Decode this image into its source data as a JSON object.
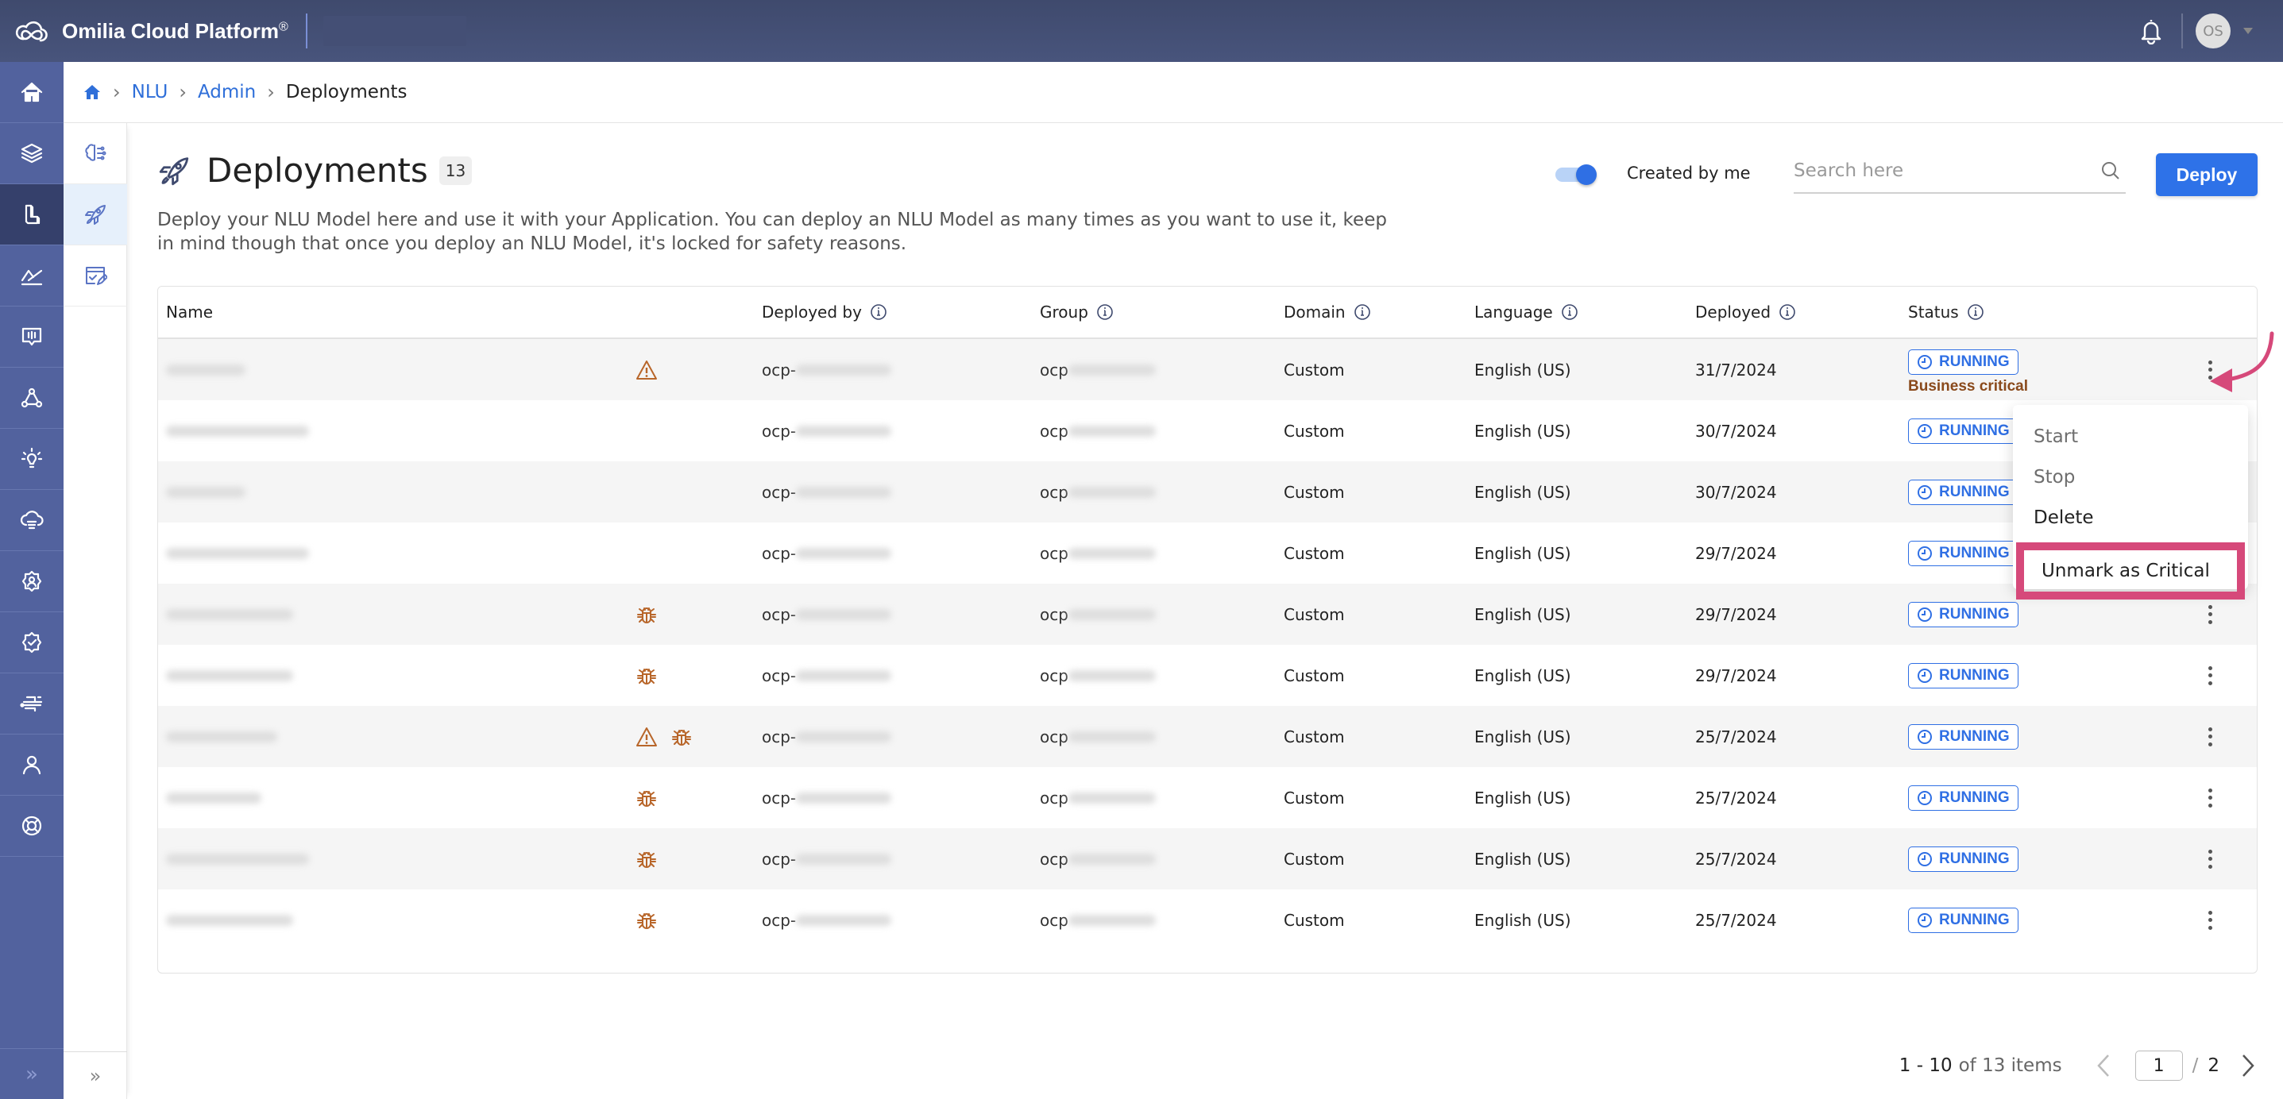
{
  "topbar": {
    "brand_name": "Omilia Cloud Platform",
    "brand_mark": "®",
    "avatar_initials": "OS"
  },
  "rail": {
    "items": [
      {
        "icon": "home-icon",
        "active": false
      },
      {
        "icon": "layers-icon",
        "active": false
      },
      {
        "icon": "nlu-blocks-icon",
        "active": true
      },
      {
        "icon": "analytics-icon",
        "active": false
      },
      {
        "icon": "reports-icon",
        "active": false
      },
      {
        "icon": "network-icon",
        "active": false
      },
      {
        "icon": "lightbulb-icon",
        "active": false
      },
      {
        "icon": "cloud-data-icon",
        "active": false
      },
      {
        "icon": "user-settings-icon",
        "active": false
      },
      {
        "icon": "badge-check-icon",
        "active": false
      },
      {
        "icon": "circuit-icon",
        "active": false
      },
      {
        "icon": "user-icon",
        "active": false
      },
      {
        "icon": "support-icon",
        "active": false
      }
    ],
    "expand_glyph": "»"
  },
  "subbar": {
    "items": [
      {
        "icon": "brain-icon",
        "active": false
      },
      {
        "icon": "rocket-icon",
        "active": true
      },
      {
        "icon": "form-edit-icon",
        "active": false
      }
    ],
    "expand_glyph": "»"
  },
  "breadcrumb": {
    "items": [
      "NLU",
      "Admin"
    ],
    "current": "Deployments",
    "separator": "›"
  },
  "page": {
    "title": "Deployments",
    "count": "13",
    "description": "Deploy your NLU Model here and use it with your Application. You can deploy an NLU Model as many times as you want to use it, keep in mind though that once you deploy an NLU Model, it's locked for safety reasons.",
    "toggle_label": "Created by me",
    "toggle_on": true,
    "search_placeholder": "Search here",
    "search_value": "",
    "deploy_label": "Deploy"
  },
  "table": {
    "columns": [
      "Name",
      "Deployed by",
      "Group",
      "Domain",
      "Language",
      "Deployed",
      "Status"
    ],
    "rows": [
      {
        "name_redacted": true,
        "name_len": 5,
        "flags": [
          "warning"
        ],
        "deployed_by": "ocp-",
        "group": "ocp",
        "domain": "Custom",
        "language": "English (US)",
        "deployed": "31/7/2024",
        "status": "RUNNING",
        "critical": "Business critical"
      },
      {
        "name_redacted": true,
        "name_len": 9,
        "flags": [],
        "deployed_by": "ocp-",
        "group": "ocp",
        "domain": "Custom",
        "language": "English (US)",
        "deployed": "30/7/2024",
        "status": "RUNNING",
        "critical": ""
      },
      {
        "name_redacted": true,
        "name_len": 5,
        "flags": [],
        "deployed_by": "ocp-",
        "group": "ocp",
        "domain": "Custom",
        "language": "English (US)",
        "deployed": "30/7/2024",
        "status": "RUNNING",
        "critical": ""
      },
      {
        "name_redacted": true,
        "name_len": 9,
        "flags": [],
        "deployed_by": "ocp-",
        "group": "ocp",
        "domain": "Custom",
        "language": "English (US)",
        "deployed": "29/7/2024",
        "status": "RUNNING",
        "critical": ""
      },
      {
        "name_redacted": true,
        "name_len": 8,
        "flags": [
          "bug"
        ],
        "deployed_by": "ocp-",
        "group": "ocp",
        "domain": "Custom",
        "language": "English (US)",
        "deployed": "29/7/2024",
        "status": "RUNNING",
        "critical": ""
      },
      {
        "name_redacted": true,
        "name_len": 8,
        "flags": [
          "bug"
        ],
        "deployed_by": "ocp-",
        "group": "ocp",
        "domain": "Custom",
        "language": "English (US)",
        "deployed": "29/7/2024",
        "status": "RUNNING",
        "critical": ""
      },
      {
        "name_redacted": true,
        "name_len": 7,
        "flags": [
          "warning",
          "bug"
        ],
        "deployed_by": "ocp-",
        "group": "ocp",
        "domain": "Custom",
        "language": "English (US)",
        "deployed": "25/7/2024",
        "status": "RUNNING",
        "critical": ""
      },
      {
        "name_redacted": true,
        "name_len": 6,
        "flags": [
          "bug"
        ],
        "deployed_by": "ocp-",
        "group": "ocp",
        "domain": "Custom",
        "language": "English (US)",
        "deployed": "25/7/2024",
        "status": "RUNNING",
        "critical": ""
      },
      {
        "name_redacted": true,
        "name_len": 9,
        "flags": [
          "bug"
        ],
        "deployed_by": "ocp-",
        "group": "ocp",
        "domain": "Custom",
        "language": "English (US)",
        "deployed": "25/7/2024",
        "status": "RUNNING",
        "critical": ""
      },
      {
        "name_redacted": true,
        "name_len": 8,
        "flags": [
          "bug"
        ],
        "deployed_by": "ocp-",
        "group": "ocp",
        "domain": "Custom",
        "language": "English (US)",
        "deployed": "25/7/2024",
        "status": "RUNNING",
        "critical": ""
      }
    ]
  },
  "context_menu": {
    "items": [
      {
        "label": "Start",
        "enabled": false
      },
      {
        "label": "Stop",
        "enabled": false
      },
      {
        "label": "Delete",
        "enabled": true
      },
      {
        "label": "Unmark as Critical",
        "enabled": true,
        "highlighted": true
      }
    ]
  },
  "annotation": {
    "color": "#d6497a"
  },
  "pagination": {
    "range": "1 - 10",
    "of_label": "of 13 items",
    "current_page": "1",
    "separator": "/",
    "total_pages": "2"
  },
  "colors": {
    "accent": "#2e72e8",
    "rail": "#52629e",
    "topbar": "#414c70",
    "warning": "#b8662a",
    "critical_text": "#8a4a1c"
  }
}
